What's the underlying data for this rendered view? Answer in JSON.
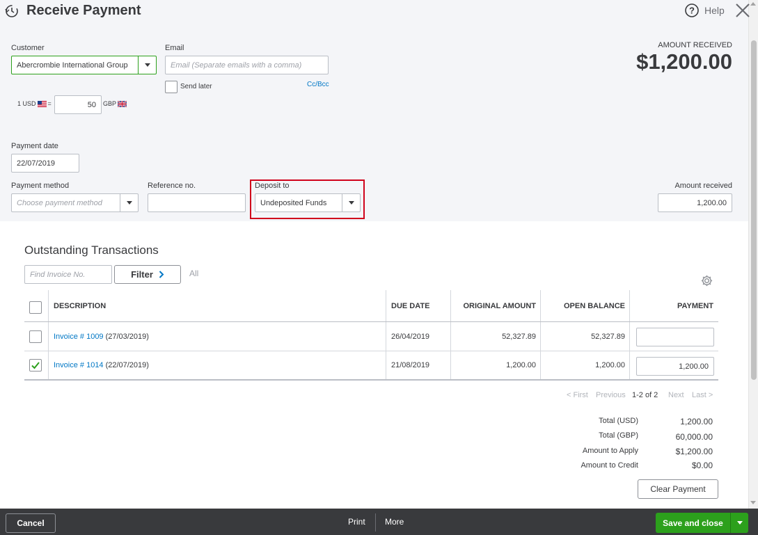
{
  "header": {
    "title": "Receive Payment",
    "help_label": "Help"
  },
  "customer": {
    "label": "Customer",
    "value": "Abercrombie International Group"
  },
  "email": {
    "label": "Email",
    "placeholder": "Email (Separate emails with a comma)",
    "send_later_label": "Send later",
    "cc_bcc_label": "Cc/Bcc"
  },
  "exchange": {
    "base_label": "1 USD",
    "equals": "=",
    "rate": "50",
    "target_label": "GBP"
  },
  "amount_summary": {
    "label": "AMOUNT RECEIVED",
    "value": "$1,200.00"
  },
  "payment_date": {
    "label": "Payment date",
    "value": "22/07/2019"
  },
  "payment_method": {
    "label": "Payment method",
    "placeholder": "Choose payment method"
  },
  "reference": {
    "label": "Reference no.",
    "value": ""
  },
  "deposit_to": {
    "label": "Deposit to",
    "value": "Undeposited Funds"
  },
  "amount_received": {
    "label": "Amount received",
    "value": "1,200.00"
  },
  "outstanding": {
    "title": "Outstanding Transactions",
    "find_placeholder": "Find Invoice No.",
    "filter_label": "Filter",
    "all_label": "All",
    "columns": [
      "DESCRIPTION",
      "DUE DATE",
      "ORIGINAL AMOUNT",
      "OPEN BALANCE",
      "PAYMENT"
    ],
    "rows": [
      {
        "link": "Invoice # 1009",
        "date_suffix": "(27/03/2019)",
        "due_date": "26/04/2019",
        "original": "52,327.89",
        "open": "52,327.89",
        "payment": "",
        "checked": false
      },
      {
        "link": "Invoice # 1014",
        "date_suffix": "(22/07/2019)",
        "due_date": "21/08/2019",
        "original": "1,200.00",
        "open": "1,200.00",
        "payment": "1,200.00",
        "checked": true
      }
    ],
    "pager": {
      "first": "< First",
      "previous": "Previous",
      "range": "1-2 of 2",
      "next": "Next",
      "last": "Last >"
    }
  },
  "totals": [
    {
      "label": "Total (USD)",
      "value": "1,200.00"
    },
    {
      "label": "Total (GBP)",
      "value": "60,000.00"
    },
    {
      "label": "Amount to Apply",
      "value": "$1,200.00"
    },
    {
      "label": "Amount to Credit",
      "value": "$0.00"
    }
  ],
  "clear_payment_label": "Clear Payment",
  "footer": {
    "cancel_label": "Cancel",
    "print_label": "Print",
    "more_label": "More",
    "save_label": "Save and close"
  },
  "colors": {
    "accent_green": "#2ca01c",
    "link_blue": "#0077c5",
    "highlight_red": "#d0021b",
    "footer_bg": "#393a3d"
  }
}
